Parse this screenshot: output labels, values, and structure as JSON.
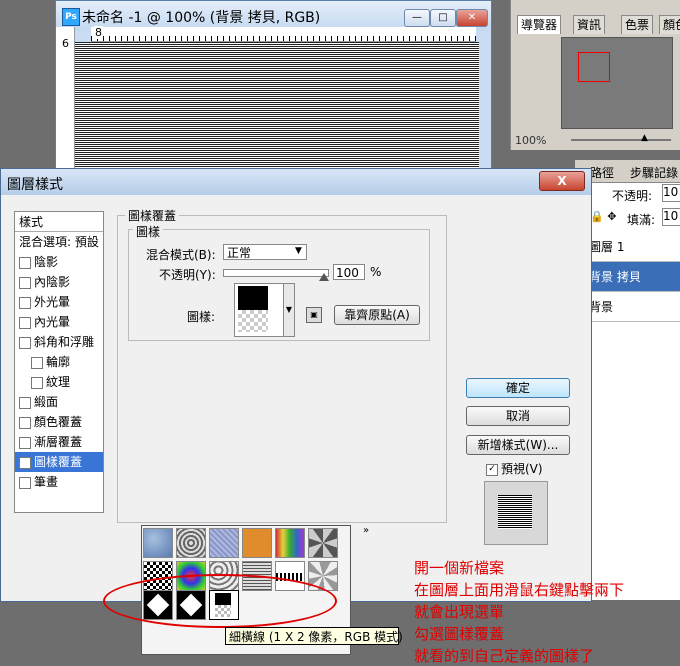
{
  "doc_window": {
    "title": "未命名 -1 @ 100% (背景 拷貝, RGB)",
    "ruler_top_label": "8",
    "ruler_left_label": "6",
    "min_glyph": "—",
    "max_glyph": "□",
    "close_glyph": "✕"
  },
  "nav_panel": {
    "tabs": [
      "導覽器",
      "資訊",
      "色票",
      "顏色"
    ],
    "zoom": "100%"
  },
  "layers_panel": {
    "tabs": [
      "路徑",
      "步驟記錄"
    ],
    "opacity_label": "不透明:",
    "opacity_value": "10",
    "fill_label": "填滿:",
    "fill_value": "10",
    "layers": [
      "圖層 1",
      "背景 拷貝",
      "背景"
    ]
  },
  "dialog": {
    "title": "圖層樣式",
    "close_glyph": "X",
    "style_header": "樣式",
    "styles": [
      {
        "label": "混合選項: 預設",
        "checkbox": false,
        "sub": false,
        "checked": false,
        "active": false
      },
      {
        "label": "陰影",
        "checkbox": true,
        "sub": false,
        "checked": false,
        "active": false
      },
      {
        "label": "內陰影",
        "checkbox": true,
        "sub": false,
        "checked": false,
        "active": false
      },
      {
        "label": "外光暈",
        "checkbox": true,
        "sub": false,
        "checked": false,
        "active": false
      },
      {
        "label": "內光暈",
        "checkbox": true,
        "sub": false,
        "checked": false,
        "active": false
      },
      {
        "label": "斜角和浮雕",
        "checkbox": true,
        "sub": false,
        "checked": false,
        "active": false
      },
      {
        "label": "輪廓",
        "checkbox": true,
        "sub": true,
        "checked": false,
        "active": false
      },
      {
        "label": "紋理",
        "checkbox": true,
        "sub": true,
        "checked": false,
        "active": false
      },
      {
        "label": "緞面",
        "checkbox": true,
        "sub": false,
        "checked": false,
        "active": false
      },
      {
        "label": "顏色覆蓋",
        "checkbox": true,
        "sub": false,
        "checked": false,
        "active": false
      },
      {
        "label": "漸層覆蓋",
        "checkbox": true,
        "sub": false,
        "checked": false,
        "active": false
      },
      {
        "label": "圖樣覆蓋",
        "checkbox": true,
        "sub": false,
        "checked": true,
        "active": true
      },
      {
        "label": "筆畫",
        "checkbox": true,
        "sub": false,
        "checked": false,
        "active": false
      }
    ],
    "group_title": "圖樣覆蓋",
    "subgroup_title": "圖樣",
    "blend_label": "混合模式(B):",
    "blend_value": "正常",
    "opacity_label": "不透明(Y):",
    "opacity_value": "100",
    "opacity_unit": "%",
    "opacity_level": 1.0,
    "pattern_label": "圖樣:",
    "snap_button": "靠齊原點(A)",
    "more_glyph": "»",
    "tooltip": "細橫線 (1 X 2 像素，RGB 模式)",
    "ok_button": "確定",
    "cancel_button": "取消",
    "new_style_button": "新增樣式(W)...",
    "preview_label": "預視(V)",
    "preview_checked": true
  },
  "notes": [
    "開一個新檔案",
    "在圖層上面用滑鼠右鍵點擊兩下",
    "就會出現選單",
    "勾選圖樣覆蓋",
    "就看的到自己定義的圖樣了"
  ],
  "colors": {
    "annotation_red": "#e00000",
    "selection_blue": "#3875d7",
    "layer_selected": "#3a6fb8"
  },
  "icons": [
    "photoshop-doc-icon",
    "lock-icon",
    "checkbox-icon",
    "dropdown-arrow-icon",
    "chevron-right-icon"
  ]
}
